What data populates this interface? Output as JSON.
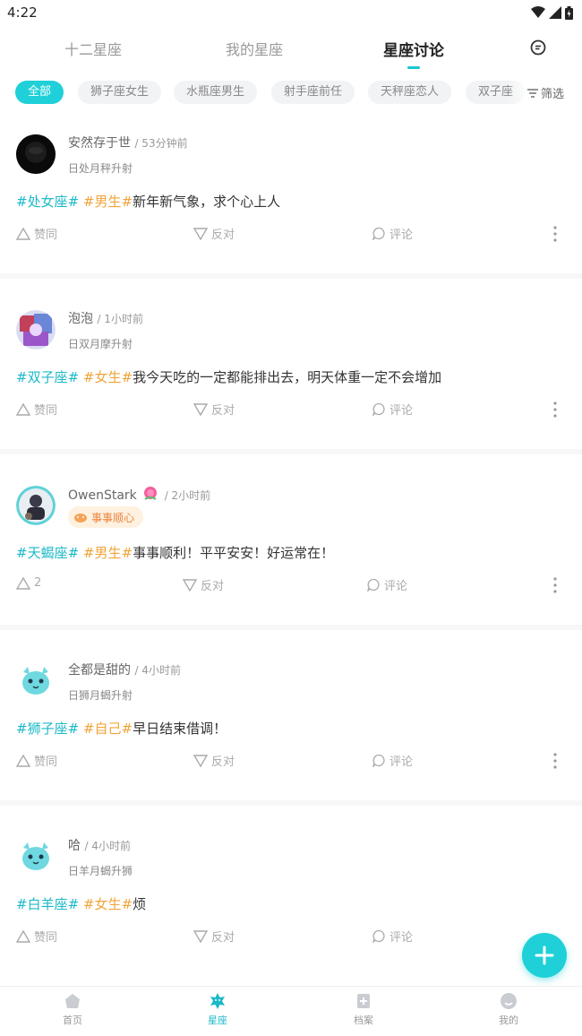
{
  "status_bar": {
    "time": "4:22"
  },
  "top_tabs": {
    "tabs": [
      {
        "label": "十二星座"
      },
      {
        "label": "我的星座"
      },
      {
        "label": "星座讨论"
      }
    ],
    "active_index": 2
  },
  "filters": {
    "chips": [
      "全部",
      "狮子座女生",
      "水瓶座男生",
      "射手座前任",
      "天秤座恋人",
      "双子座"
    ],
    "active_index": 0,
    "filter_label": "筛选"
  },
  "posts": [
    {
      "author": "安然存于世",
      "time": "/ 53分钟前",
      "signs": "日处月秤升射",
      "tag_sign": "#处女座#",
      "tag_gender": "#男生#",
      "text": "新年新气象，求个心上人",
      "like": "赞同",
      "dislike": "反对",
      "comment": "评论"
    },
    {
      "author": "泡泡",
      "time": "/ 1小时前",
      "signs": "日双月摩升射",
      "tag_sign": "#双子座#",
      "tag_gender": "#女生#",
      "text": "我今天吃的一定都能排出去，明天体重一定不会增加",
      "like": "赞同",
      "dislike": "反对",
      "comment": "评论"
    },
    {
      "author": "OwenStark",
      "time": "/ 2小时前",
      "badge": "事事顺心",
      "tag_sign": "#天蝎座#",
      "tag_gender": "#男生#",
      "text": "事事顺利！平平安安！好运常在！",
      "like": "2",
      "dislike": "反对",
      "comment": "评论"
    },
    {
      "author": "全都是甜的",
      "time": "/ 4小时前",
      "signs": "日狮月蝎升射",
      "tag_sign": "#狮子座#",
      "tag_gender": "#自己#",
      "text": "早日结束借调！",
      "like": "赞同",
      "dislike": "反对",
      "comment": "评论"
    },
    {
      "author": "哈",
      "time": "/ 4小时前",
      "signs": "日羊月蝎升狮",
      "tag_sign": "#白羊座#",
      "tag_gender": "#女生#",
      "text": "烦",
      "like": "赞同",
      "dislike": "反对",
      "comment": "评论"
    }
  ],
  "bottom_nav": {
    "items": [
      {
        "label": "首页"
      },
      {
        "label": "星座"
      },
      {
        "label": "档案"
      },
      {
        "label": "我的"
      }
    ],
    "active_index": 1
  },
  "colors": {
    "accent": "#1fd0d8",
    "tag_sign": "#1bb9c8",
    "tag_gender": "#f0a43a"
  }
}
